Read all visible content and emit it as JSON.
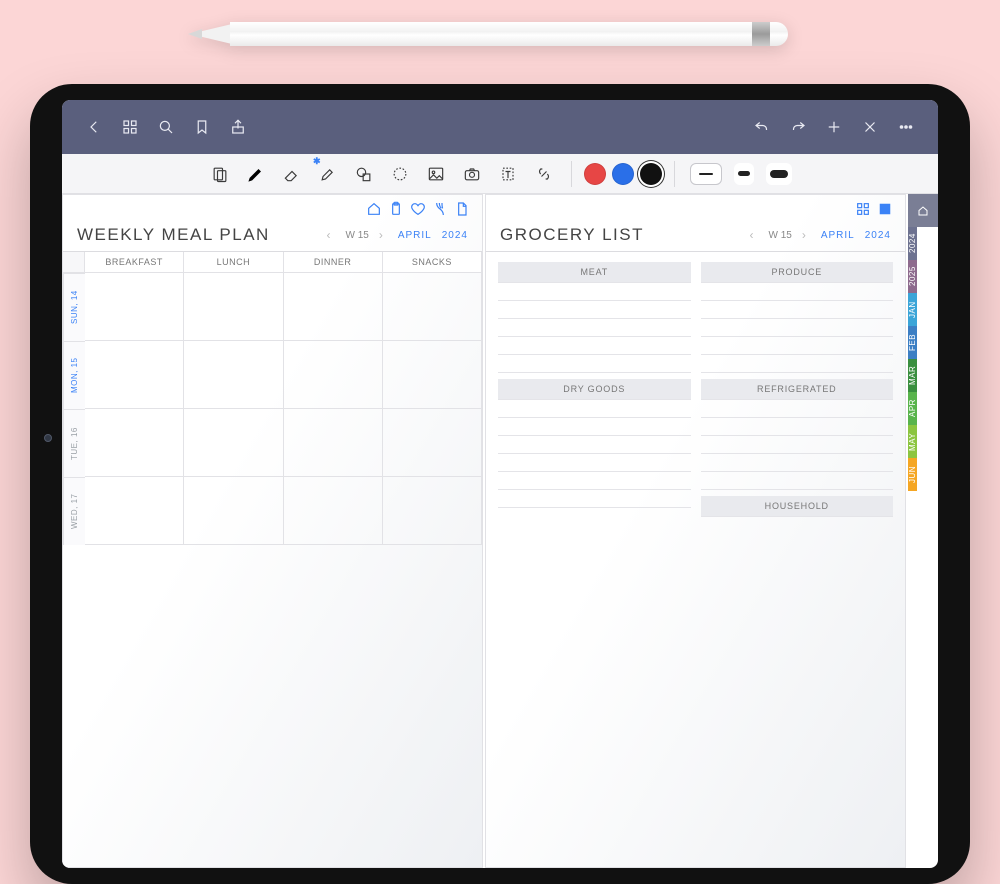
{
  "week": {
    "label": "W 15",
    "month": "APRIL",
    "year": "2024"
  },
  "left_page": {
    "title": "WEEKLY MEAL PLAN",
    "icons": [
      "home",
      "clipboard",
      "heart",
      "whisk",
      "document"
    ],
    "columns": [
      "BREAKFAST",
      "LUNCH",
      "DINNER",
      "SNACKS"
    ],
    "days": [
      {
        "label": "SUN, 14",
        "hl": true
      },
      {
        "label": "MON, 15",
        "hl": true
      },
      {
        "label": "TUE, 16",
        "hl": false
      },
      {
        "label": "WED, 17",
        "hl": false
      }
    ]
  },
  "right_page": {
    "title": "GROCERY LIST",
    "icons": [
      "grid",
      "scan"
    ],
    "cols": [
      {
        "sections": [
          {
            "h": "MEAT",
            "lines": 5
          },
          {
            "h": "DRY GOODS",
            "lines": 6
          }
        ]
      },
      {
        "sections": [
          {
            "h": "PRODUCE",
            "lines": 5
          },
          {
            "h": "REFRIGERATED",
            "lines": 5
          },
          {
            "h": "HOUSEHOLD",
            "lines": 0
          }
        ]
      }
    ]
  },
  "colors": {
    "swatches": [
      "#e74645",
      "#2a6fe8",
      "#111111"
    ],
    "selectedIndex": 2
  },
  "sidetabs": [
    {
      "label": "",
      "color": "#7a7e95"
    },
    {
      "label": "2024",
      "color": "#6d7290"
    },
    {
      "label": "2025",
      "color": "#8e6b8e"
    },
    {
      "label": "JAN",
      "color": "#3ba5d8"
    },
    {
      "label": "FEB",
      "color": "#3c7fc4"
    },
    {
      "label": "MAR",
      "color": "#3a8f3f"
    },
    {
      "label": "APR",
      "color": "#59b44c"
    },
    {
      "label": "MAY",
      "color": "#8cc540"
    },
    {
      "label": "JUN",
      "color": "#f5a623"
    }
  ]
}
